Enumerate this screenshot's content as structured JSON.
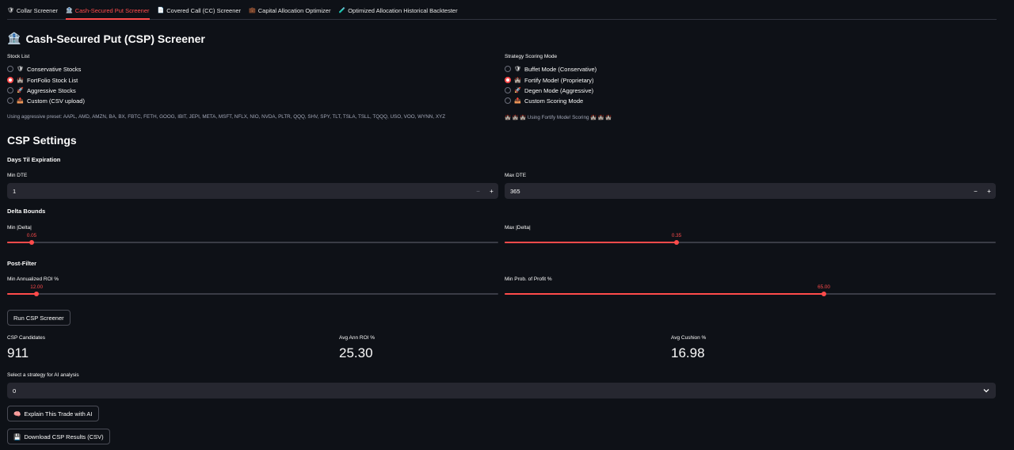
{
  "tabs": [
    {
      "icon": "🛡",
      "label": "Collar Screener"
    },
    {
      "icon": "🏦",
      "label": "Cash-Secured Put Screener"
    },
    {
      "icon": "📄",
      "label": "Covered Call (CC) Screener"
    },
    {
      "icon": "💼",
      "label": "Capital Allocation Optimizer"
    },
    {
      "icon": "🧪",
      "label": "Optimized Allocation Historical Backtester"
    }
  ],
  "active_tab": 1,
  "page_title": {
    "icon": "🏦",
    "text": "Cash-Secured Put (CSP) Screener"
  },
  "stock_list": {
    "label": "Stock List",
    "options": [
      {
        "icon": "🛡",
        "label": "Conservative Stocks"
      },
      {
        "icon": "🏰",
        "label": "FortFolio Stock List"
      },
      {
        "icon": "🚀",
        "label": "Aggressive Stocks"
      },
      {
        "icon": "📤",
        "label": "Custom (CSV upload)"
      }
    ],
    "selected": 1,
    "caption": "Using aggressive preset: AAPL, AMD, AMZN, BA, BX, FBTC, FETH, GOOG, IBIT, JEPI, META, MSFT, NFLX, NIO, NVDA, PLTR, QQQ, SHV, SPY, TLT, TSLA, TSLL, TQQQ, USO, VOO, WYNN, XYZ"
  },
  "scoring_mode": {
    "label": "Strategy Scoring Mode",
    "options": [
      {
        "icon": "🛡",
        "label": "Buffet Mode (Conservative)"
      },
      {
        "icon": "🏰",
        "label": "Fortify Mode! (Proprietary)"
      },
      {
        "icon": "🚀",
        "label": "Degen Mode (Aggressive)"
      },
      {
        "icon": "📤",
        "label": "Custom Scoring Mode"
      }
    ],
    "selected": 1,
    "caption": "🏰 🏰 🏰 Using Fortify Mode! Scoring 🏰 🏰 🏰"
  },
  "settings": {
    "title": "CSP Settings",
    "dte_heading": "Days Til Expiration",
    "min_dte": {
      "label": "Min DTE",
      "value": "1",
      "minus": "−",
      "plus": "+"
    },
    "max_dte": {
      "label": "Max DTE",
      "value": "365",
      "minus": "−",
      "plus": "+"
    },
    "delta_heading": "Delta Bounds",
    "min_delta": {
      "label": "Min |Delta|",
      "value_text": "0.05",
      "fraction": 0.05
    },
    "max_delta": {
      "label": "Max |Delta|",
      "value_text": "0.35",
      "fraction": 0.35
    },
    "post_heading": "Post-Filter",
    "min_roi": {
      "label": "Min Annualized ROI %",
      "value_text": "12.00",
      "fraction": 0.06
    },
    "min_pop": {
      "label": "Min Prob. of Profit %",
      "value_text": "65.00",
      "fraction": 0.65
    }
  },
  "run_button": "Run CSP Screener",
  "metrics": [
    {
      "label": "CSP Candidates",
      "value": "911"
    },
    {
      "label": "Avg Ann ROI %",
      "value": "25.30"
    },
    {
      "label": "Avg Cushion %",
      "value": "16.98"
    }
  ],
  "strategy_select": {
    "label": "Select a strategy for AI analysis",
    "value": "0"
  },
  "explain_button": {
    "icon": "🧠",
    "label": "Explain This Trade with AI"
  },
  "download_button": {
    "icon": "💾",
    "label": "Download CSP Results (CSV)"
  },
  "colors": {
    "accent": "#ff4b4b",
    "background": "#0e1117",
    "input_bg": "#262730"
  }
}
